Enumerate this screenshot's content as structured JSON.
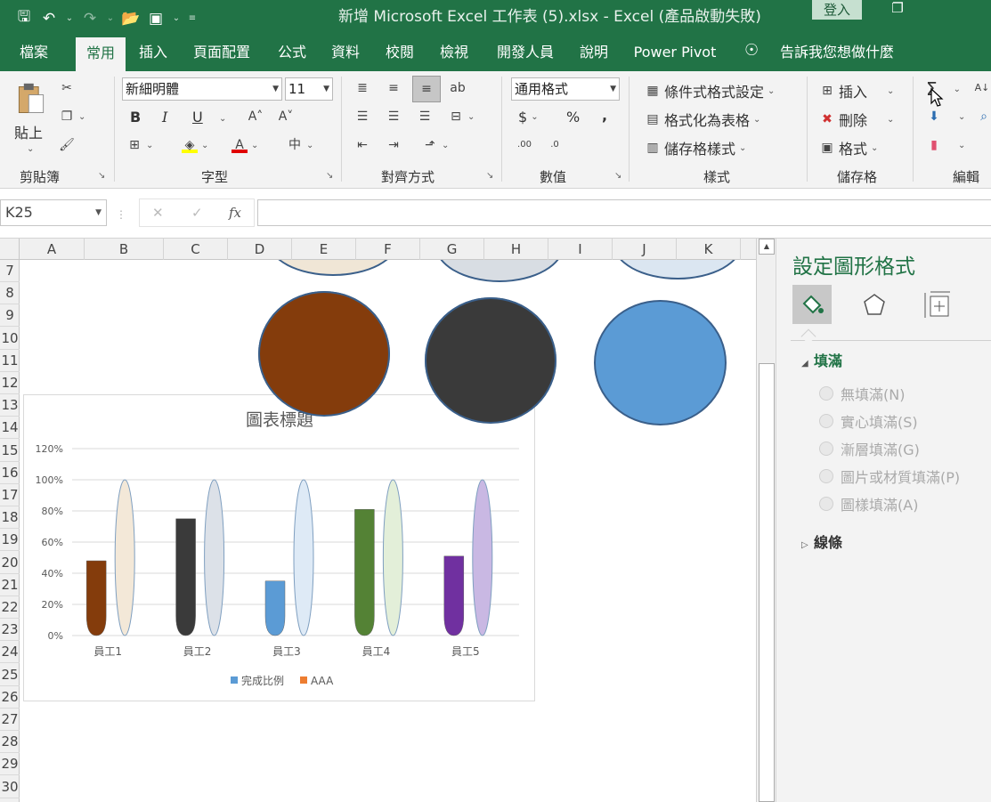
{
  "window": {
    "title": "新增 Microsoft Excel 工作表 (5).xlsx  -  Excel (產品啟動失敗)",
    "login": "登入"
  },
  "tabs": [
    "檔案",
    "常用",
    "插入",
    "頁面配置",
    "公式",
    "資料",
    "校閱",
    "檢視",
    "開發人員",
    "說明",
    "Power Pivot"
  ],
  "active_tab": "常用",
  "tell_me": "告訴我您想做什麼",
  "ribbon": {
    "clipboard": {
      "paste": "貼上",
      "label": "剪貼簿"
    },
    "font": {
      "name": "新細明體",
      "size": "11",
      "bold": "B",
      "italic": "I",
      "underline": "U",
      "label": "字型"
    },
    "alignment": {
      "label": "對齊方式"
    },
    "number": {
      "format": "通用格式",
      "currency": "$",
      "percent": "%",
      "comma": ",",
      "label": "數值"
    },
    "styles": {
      "conditional": "條件式格式設定",
      "table": "格式化為表格",
      "cell_styles": "儲存格樣式",
      "label": "樣式"
    },
    "cells": {
      "insert": "插入",
      "delete": "刪除",
      "format": "格式",
      "label": "儲存格"
    },
    "editing": {
      "sum": "Σ",
      "label": "編輯"
    }
  },
  "formula_bar": {
    "name_box": "K25",
    "fx": "fx",
    "value": ""
  },
  "columns": [
    "A",
    "B",
    "C",
    "D",
    "E",
    "F",
    "G",
    "H",
    "I",
    "J",
    "K"
  ],
  "rows": [
    "7",
    "8",
    "9",
    "10",
    "11",
    "12",
    "13",
    "14",
    "15",
    "16",
    "17",
    "18",
    "19",
    "20",
    "21",
    "22",
    "23",
    "24",
    "25",
    "26",
    "27",
    "28",
    "29",
    "30"
  ],
  "circles": {
    "top_colors": [
      "#f0e6d6",
      "#d8dde3",
      "#dbe6f1"
    ],
    "bottom_colors": [
      "#843c0c",
      "#3a3a3a",
      "#5b9bd5"
    ]
  },
  "chart_data": {
    "type": "bar",
    "title": "圖表標題",
    "categories": [
      "員工1",
      "員工2",
      "員工3",
      "員工4",
      "員工5"
    ],
    "series": [
      {
        "name": "完成比例",
        "values": [
          0.48,
          0.75,
          0.35,
          0.81,
          0.51
        ],
        "legend_color": "#5b9bd5"
      },
      {
        "name": "AAA",
        "values": [
          1.0,
          1.0,
          1.0,
          1.0,
          1.0
        ],
        "legend_color": "#ed7d31"
      }
    ],
    "bar_colors": [
      "#843c0c",
      "#3a3a3a",
      "#5b9bd5",
      "#548235",
      "#7030a0"
    ],
    "ghost_colors": [
      "#f3e8d8",
      "#dce1e8",
      "#deeaf6",
      "#e3efd9",
      "#c9b8e3"
    ],
    "yticks": [
      "0%",
      "20%",
      "40%",
      "60%",
      "80%",
      "100%",
      "120%"
    ],
    "ylim": [
      0,
      1.2
    ],
    "grid": true,
    "legend_position": "bottom"
  },
  "pane": {
    "title": "設定圖形格式",
    "fill_section": "填滿",
    "fill_options": [
      "無填滿(N)",
      "實心填滿(S)",
      "漸層填滿(G)",
      "圖片或材質填滿(P)",
      "圖樣填滿(A)"
    ],
    "line_section": "線條"
  }
}
